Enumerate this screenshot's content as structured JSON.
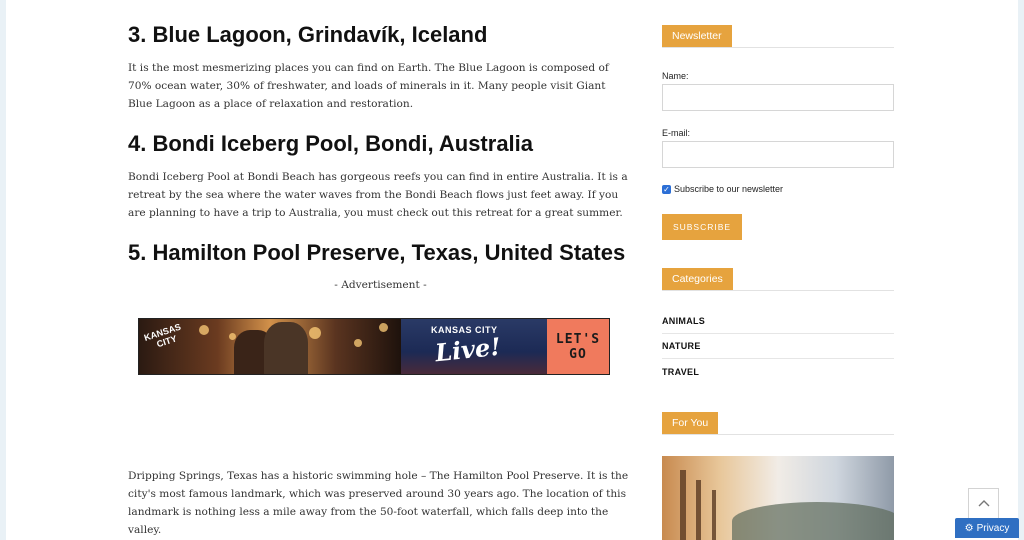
{
  "article": {
    "section3": {
      "heading": "3. Blue Lagoon, Grindavík, Iceland",
      "body": "It is the most mesmerizing places you can find on Earth. The Blue Lagoon is composed of 70% ocean water, 30% of freshwater, and loads of minerals in it. Many people visit Giant Blue Lagoon as a place of relaxation and restoration."
    },
    "section4": {
      "heading": "4. Bondi Iceberg Pool, Bondi, Australia",
      "body": "Bondi Iceberg Pool at Bondi Beach has gorgeous reefs you can find in entire Australia. It is a retreat by the sea where the water waves from the Bondi Beach flows just feet away. If you are planning to have a trip to Australia, you must check out this retreat for a great summer."
    },
    "section5": {
      "heading": "5. Hamilton Pool Preserve, Texas, United States",
      "body": "Dripping Springs, Texas has a historic swimming hole – The Hamilton Pool Preserve. It is the city's most famous landmark, which was preserved around 30 years ago. The location of this landmark is nothing less a mile away from the 50-foot waterfall, which falls deep into the valley."
    },
    "ad": {
      "label": "- Advertisement -",
      "badge_line1": "KANSAS",
      "badge_line2": "CITY",
      "mid_line1": "KANSAS CITY",
      "mid_line2": "Live!",
      "cta_line1": "LET'S",
      "cta_line2": "GO"
    }
  },
  "sidebar": {
    "newsletter": {
      "title": "Newsletter",
      "name_label": "Name:",
      "name_value": "",
      "email_label": "E-mail:",
      "email_value": "",
      "subscribe_checkbox_label": "Subscribe to our newsletter",
      "subscribe_checked": true,
      "subscribe_button": "SUBSCRIBE"
    },
    "categories": {
      "title": "Categories",
      "items": [
        "ANIMALS",
        "NATURE",
        "TRAVEL"
      ]
    },
    "for_you": {
      "title": "For You"
    }
  },
  "floating": {
    "privacy_label": "Privacy",
    "scroll_top_icon": "chevron-up-icon"
  },
  "colors": {
    "accent": "#e6a33e",
    "privacy_blue": "#2f6fc2",
    "ad_cta": "#f07a5d"
  }
}
